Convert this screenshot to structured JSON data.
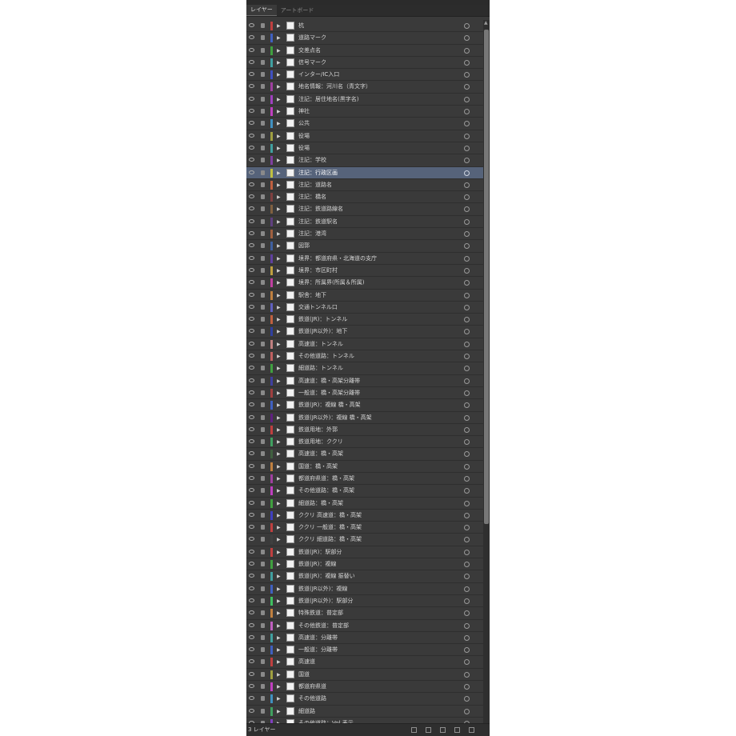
{
  "panel": {
    "tabs": [
      {
        "label": "レイヤー",
        "active": true
      },
      {
        "label": "アートボード",
        "active": false
      }
    ],
    "footer_label": "3 レイヤー",
    "icons": {
      "visibility": "eye-icon",
      "lock": "lock-icon",
      "expand": "triangle-right-icon",
      "target": "target-circle-icon"
    }
  },
  "layers": [
    {
      "name": "杭",
      "color": "#c04040"
    },
    {
      "name": "道路マーク",
      "color": "#4060c0"
    },
    {
      "name": "交差点名",
      "color": "#40a040"
    },
    {
      "name": "信号マーク",
      "color": "#40a0a0"
    },
    {
      "name": "インター/IC入口",
      "color": "#4050c0"
    },
    {
      "name": "地名情報：河川名（青文字）",
      "color": "#a040a0"
    },
    {
      "name": "注記：居住地名(黒字名)",
      "color": "#a040c0"
    },
    {
      "name": "神社",
      "color": "#c040c0"
    },
    {
      "name": "公共",
      "color": "#4090c0"
    },
    {
      "name": "役場",
      "color": "#a0a040"
    },
    {
      "name": "役場",
      "color": "#40a0a0"
    },
    {
      "name": "注記：学校",
      "color": "#8040a0"
    },
    {
      "name": "注記：行政区画",
      "color": "#c0c040",
      "selected": true
    },
    {
      "name": "注記：道路名",
      "color": "#c06040"
    },
    {
      "name": "注記：橋名",
      "color": "#804040"
    },
    {
      "name": "注記：鉄道路線名",
      "color": "#806040"
    },
    {
      "name": "注記：鉄道駅名",
      "color": "#604080"
    },
    {
      "name": "注記：港湾",
      "color": "#a06040"
    },
    {
      "name": "図郭",
      "color": "#4060a0"
    },
    {
      "name": "境界：都道府県・北海道の支庁",
      "color": "#6040a0"
    },
    {
      "name": "境界：市区町村",
      "color": "#c0a040"
    },
    {
      "name": "境界：所属界(所属＆所属)",
      "color": "#c040a0"
    },
    {
      "name": "駅舎：地下",
      "color": "#c08040"
    },
    {
      "name": "交通トンネル口",
      "color": "#6060c0"
    },
    {
      "name": "鉄道(JR)：トンネル",
      "color": "#c06040"
    },
    {
      "name": "鉄道(JR以外)：地下",
      "color": "#3040a0"
    },
    {
      "name": "高速道：トンネル",
      "color": "#c08080"
    },
    {
      "name": "その他道路：トンネル",
      "color": "#c06060"
    },
    {
      "name": "細道路：トンネル",
      "color": "#40a040"
    },
    {
      "name": "高速道：橋・高架分離帯",
      "color": "#4040a0"
    },
    {
      "name": "一般道：橋・高架分離帯",
      "color": "#a04040"
    },
    {
      "name": "鉄道(JR)：複線 橋・高架",
      "color": "#4060c0"
    },
    {
      "name": "鉄道(JR以外)：複線 橋・高架",
      "color": "#602080"
    },
    {
      "name": "鉄道用地：外郭",
      "color": "#c04040"
    },
    {
      "name": "鉄道用地：ククリ",
      "color": "#40a060"
    },
    {
      "name": "高速道：橋・高架",
      "color": "#406040"
    },
    {
      "name": "国道：橋・高架",
      "color": "#c08040"
    },
    {
      "name": "都道府県道：橋・高架",
      "color": "#a040a0"
    },
    {
      "name": "その他道路：橋・高架",
      "color": "#c040c0"
    },
    {
      "name": "細道路：橋・高架",
      "color": "#40a040"
    },
    {
      "name": "ククリ 高速道：橋・高架",
      "color": "#4040c0"
    },
    {
      "name": "ククリ 一般道：橋・高架",
      "color": "#c04040"
    },
    {
      "name": "ククリ 細道路：橋・高架",
      "color": "#404040"
    },
    {
      "name": "鉄道(JR)：駅部分",
      "color": "#c04040"
    },
    {
      "name": "鉄道(JR)：複線",
      "color": "#40a040"
    },
    {
      "name": "鉄道(JR)：複線 振替い",
      "color": "#40a0a0"
    },
    {
      "name": "鉄道(JR以外)：複線",
      "color": "#4060c0"
    },
    {
      "name": "鉄道(JR以外)：駅部分",
      "color": "#40c060"
    },
    {
      "name": "特殊鉄道：普定部",
      "color": "#c08040"
    },
    {
      "name": "その他鉄道：普定部",
      "color": "#c060c0"
    },
    {
      "name": "高速道：分離帯",
      "color": "#40a0a0"
    },
    {
      "name": "一般道：分離帯",
      "color": "#4060c0"
    },
    {
      "name": "高速道",
      "color": "#c04040"
    },
    {
      "name": "国道",
      "color": "#a0a040"
    },
    {
      "name": "都道府県道",
      "color": "#c040c0"
    },
    {
      "name": "その他道路",
      "color": "#4090c0"
    },
    {
      "name": "細道路",
      "color": "#40a060"
    },
    {
      "name": "その他道路：Vol 表示",
      "color": "#8040c0"
    }
  ]
}
